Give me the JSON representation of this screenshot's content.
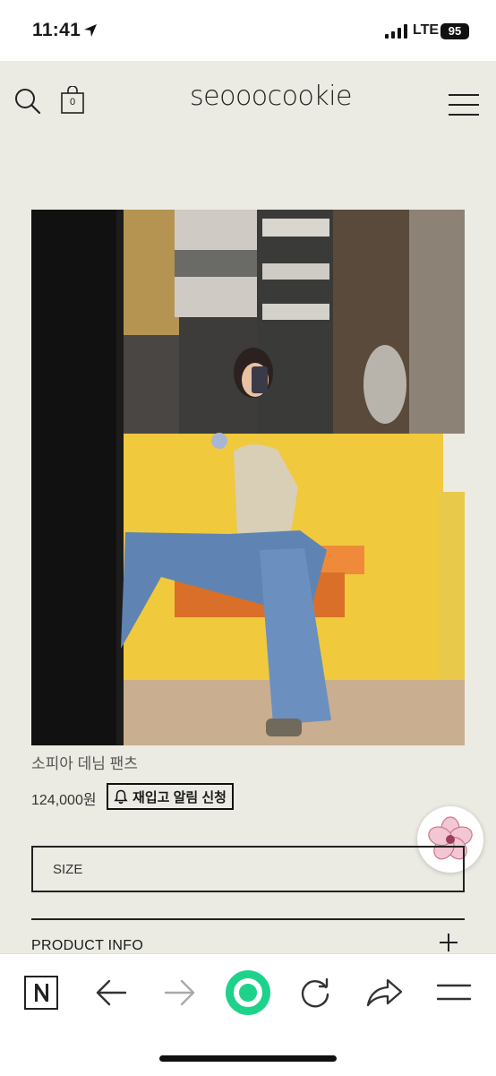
{
  "status_bar": {
    "time": "11:41",
    "network": "LTE",
    "battery": "95"
  },
  "header": {
    "logo": "seooocookie",
    "cart_count": "0"
  },
  "product": {
    "name": "소피아 데님 팬츠",
    "price": "124,000원",
    "restock_button": "재입고 알림 신청",
    "size_label": "SIZE",
    "info_label": "PRODUCT INFO"
  },
  "icons": {
    "status": [
      "location-arrow-icon",
      "signal-icon"
    ],
    "header": [
      "search-icon",
      "cart-icon",
      "menu-icon"
    ],
    "browser": [
      "naver-n-icon",
      "back-arrow-icon",
      "forward-arrow-icon",
      "green-circle-icon",
      "refresh-icon",
      "share-icon",
      "menu-icon"
    ]
  },
  "colors": {
    "page_bg": "#ebebe3",
    "green_button": "#1ed28a",
    "wall_yellow": "#f0c93c"
  }
}
